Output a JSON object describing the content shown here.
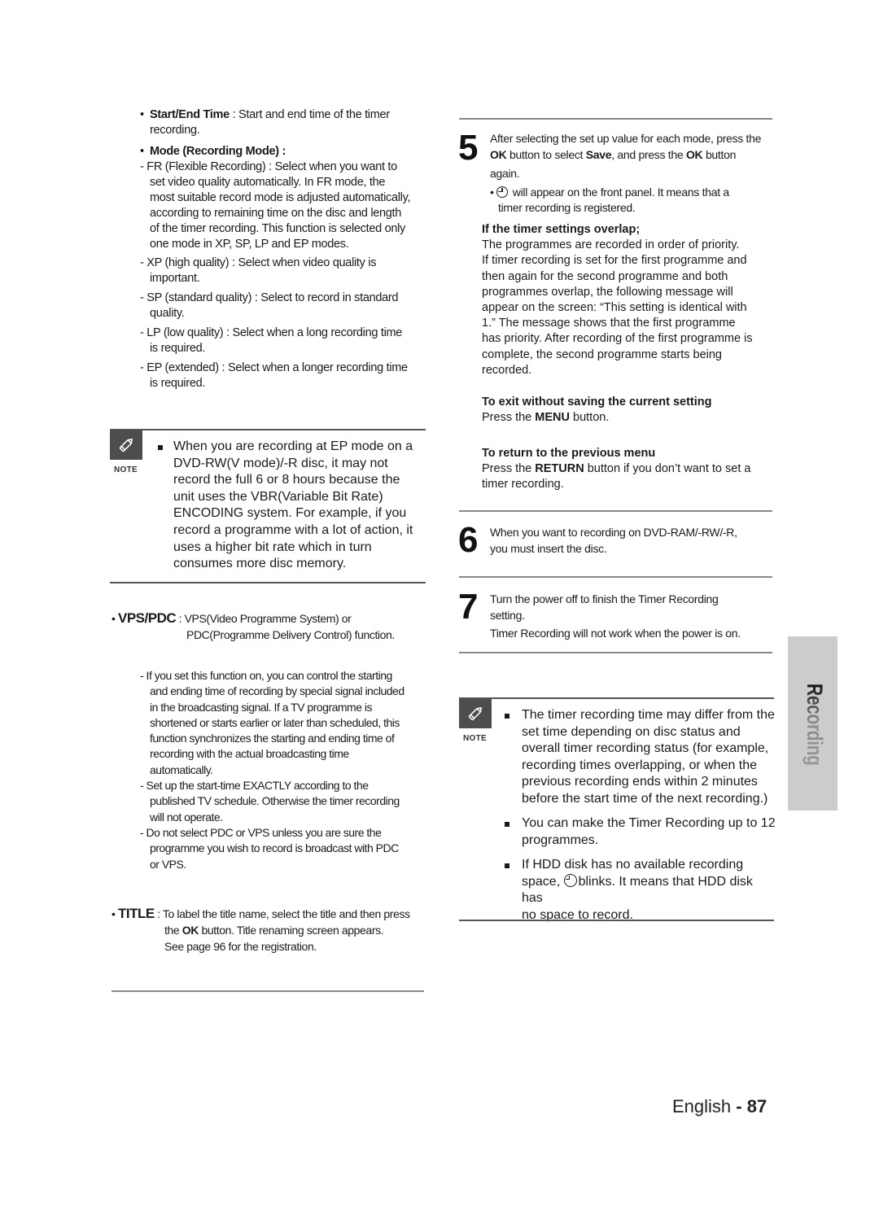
{
  "left": {
    "start_end": {
      "label": "Start/End Time",
      "text1": " : Start and end time of the timer",
      "text2": "recording."
    },
    "mode": {
      "label": "Mode (Recording Mode) :",
      "items": [
        {
          "lines": [
            "- FR (Flexible Recording) : Select when you want to",
            "set video quality automatically. In FR mode, the",
            "most suitable record mode is adjusted automatically,",
            "according to remaining time on the disc and length",
            "of the timer recording. This function is selected only",
            "one mode in XP, SP, LP and EP modes."
          ]
        },
        {
          "lines": [
            "- XP (high quality) : Select when video quality is",
            "important."
          ]
        },
        {
          "lines": [
            "- SP (standard quality) : Select to record in standard",
            "quality."
          ]
        },
        {
          "lines": [
            "- LP (low quality) : Select when a long recording time",
            "is required."
          ]
        },
        {
          "lines": [
            "- EP (extended) : Select when a longer recording time",
            "is required."
          ]
        }
      ]
    },
    "note": {
      "label": "NOTE",
      "lines": [
        "When you are recording at EP mode on a",
        "DVD-RW(V mode)/-R disc, it may not",
        "record the full 6 or 8 hours because the",
        "unit uses the VBR(Variable Bit Rate)",
        "ENCODING system. For example, if you",
        "record a programme with a lot of action, it",
        "uses a higher bit rate which in turn",
        "consumes more disc memory."
      ]
    },
    "vps": {
      "label": "VPS/PDC",
      "line1": " : VPS(Video Programme System) or",
      "line2": "PDC(Programme Delivery Control) function.",
      "items": [
        {
          "lines": [
            "- If you set this function on, you can control the starting",
            "and ending time of recording by special signal included",
            "in the broadcasting signal. If a TV programme is",
            "shortened or starts earlier or later than scheduled, this",
            "function synchronizes the starting and ending time of",
            "recording with the actual broadcasting time",
            "automatically."
          ]
        },
        {
          "lines": [
            "- Set up the start-time EXACTLY according to the",
            "published TV schedule. Otherwise the timer recording",
            "will not operate."
          ]
        },
        {
          "lines": [
            "- Do not select PDC or VPS unless you are sure the",
            "programme you wish to record is broadcast with PDC",
            "or VPS."
          ]
        }
      ]
    },
    "title": {
      "label": "TITLE",
      "line1": " : To label the title name, select the title and then press",
      "line2_pre": "the ",
      "line2_bold": "OK",
      "line2_post": " button. Title renaming screen appears.",
      "line3": "See page 96 for the registration."
    }
  },
  "right": {
    "step5": {
      "number": "5",
      "l1": "After selecting the set up value for each mode, press the",
      "l2_b1": "OK",
      "l2_t1": " button to select ",
      "l2_b2": "Save",
      "l2_t2": ", and press the ",
      "l2_b3": "OK",
      "l2_t3": " button",
      "l3": "again.",
      "sub1": " will appear on the front panel. It means that a",
      "sub2": "timer recording is registered."
    },
    "overlap": {
      "heading": "If the timer settings overlap;",
      "lines": [
        "The programmes are recorded in order of priority.",
        "If timer recording is set for the first programme and",
        "then again for the second programme and both",
        "programmes overlap, the following message will",
        "appear on the screen: “This setting is identical with",
        "1.” The message shows that the first programme",
        "has priority. After recording of the first programme is",
        "complete, the second programme starts being",
        "recorded."
      ]
    },
    "exit": {
      "heading": "To exit without saving the current setting",
      "pre": "Press the ",
      "bold": "MENU",
      "post": " button."
    },
    "return": {
      "heading": "To return to the previous menu",
      "pre": "Press the ",
      "bold": "RETURN",
      "post": " button if you don’t want to set a",
      "line2": "timer recording."
    },
    "step6": {
      "number": "6",
      "l1": "When you want to recording on DVD-RAM/-RW/-R,",
      "l2": "you must insert the disc."
    },
    "step7": {
      "number": "7",
      "l1": "Turn the power off to finish the Timer Recording",
      "l2": "setting.",
      "l3": "Timer Recording will not work when the power is on."
    },
    "note": {
      "label": "NOTE",
      "item1": [
        "The timer recording time may differ from the",
        "set time depending on disc status and",
        "overall timer recording status (for  example,",
        "recording times overlapping, or when the",
        "previous recording ends within 2 minutes",
        "before the start time of the next recording.)"
      ],
      "item2": [
        "You can make the Timer Recording up to 12",
        "programmes."
      ],
      "item3_l1": "If HDD disk has no available recording",
      "item3_l2_pre": "space, ",
      "item3_l2_post": "blinks. It means that HDD disk has",
      "item3_l3": "no space to record."
    }
  },
  "side_tab": {
    "label": "Recording"
  },
  "footer": {
    "lang": "English",
    "sep": " - ",
    "page": "87"
  }
}
